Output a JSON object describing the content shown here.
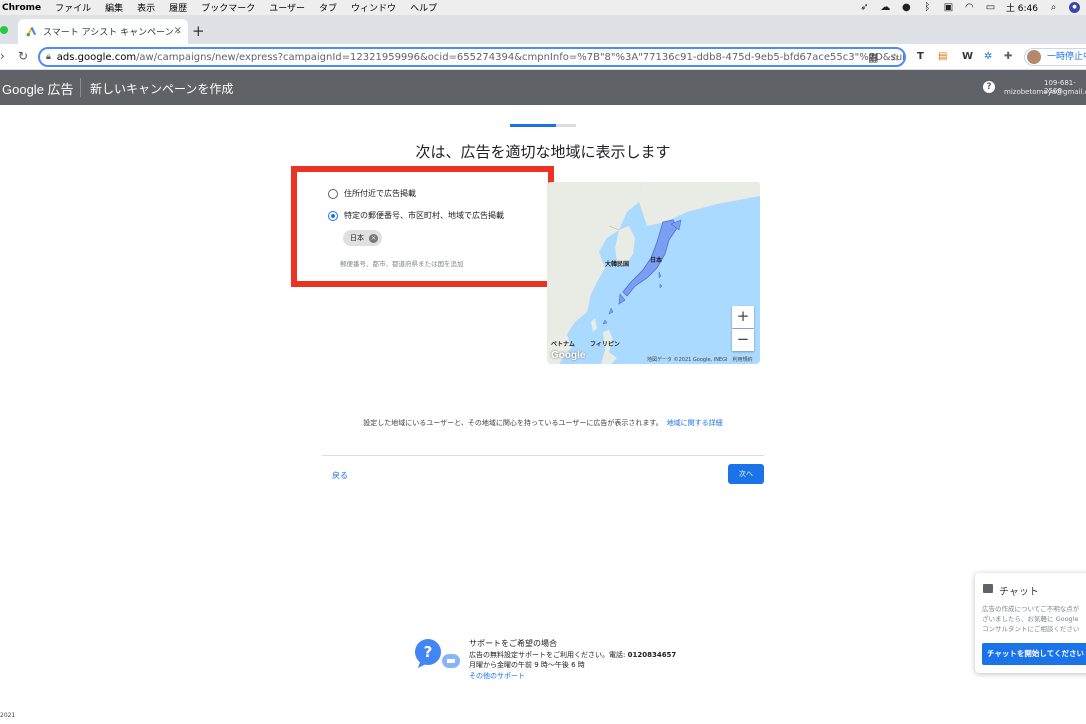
{
  "menubar": {
    "app": "Chrome",
    "items": [
      "ファイル",
      "編集",
      "表示",
      "履歴",
      "ブックマーク",
      "ユーザー",
      "タブ",
      "ウィンドウ",
      "ヘルプ"
    ],
    "clock": "土 6:46"
  },
  "tab": {
    "title": "スマート アシスト キャンペーン -",
    "close": "×",
    "new_tab": "+"
  },
  "address": {
    "host": "ads.google.com",
    "path": "/aw/campaigns/new/express?campaignId=12321959996&ocid=655274394&cmpnInfo=%7B\"8\"%3A\"77136c91-ddb8-475d-9eb5-bfd67ace55c3\"%7D&subid..."
  },
  "toolbar": {
    "pause_label": "一時停止中",
    "ext_w": "W",
    "ext_t": "T"
  },
  "header": {
    "logo": "Google 広告",
    "page_title": "新しいキャンペーンを作成",
    "help": "?",
    "account_id": "109-681-2566",
    "account_email": "mizobetomoya@gmail.com"
  },
  "progress": {
    "fraction": 0.7
  },
  "main": {
    "heading": "次は、広告を適切な地域に表示します",
    "option_near_address": "住所付近で広告掲載",
    "option_specific": "特定の郵便番号、市区町村、地域で広告掲載",
    "chip_label": "日本",
    "location_placeholder": "郵便番号、都市、都道府県または国を追加",
    "info_text": "設定した地域にいるユーザーと、その地域に関心を持っているユーザーに広告が表示されます。",
    "info_link": "地域に関する詳細",
    "back": "戻る",
    "next": "次へ"
  },
  "map": {
    "label_korea": "大韓民国",
    "label_japan": "日本",
    "label_vietnam": "ベトナム",
    "label_philippines": "フィリピン",
    "attribution": "地図データ ©2021 Google, INEGI　利用規約",
    "google_mark": "Google",
    "zoom_in": "+",
    "zoom_out": "−"
  },
  "chat": {
    "title": "チャット",
    "body_lines": [
      "広告の作成についてご不明な点が",
      "ざいましたら、お気軽に Google",
      "コンサルタントにご相談ください"
    ],
    "button": "チャットを開始してください"
  },
  "support": {
    "title": "サポートをご希望の場合",
    "line1_prefix": "広告の無料設定サポートをご利用ください。電話: ",
    "phone": "0120834657",
    "hours": "月曜から金曜の午前 9 時〜午後 6 時",
    "other_link": "その他のサポート"
  },
  "footer": {
    "year": "2021"
  },
  "colors": {
    "accent": "#1a73e8",
    "highlight": "#ea3323",
    "header_bg": "#5f6368"
  }
}
